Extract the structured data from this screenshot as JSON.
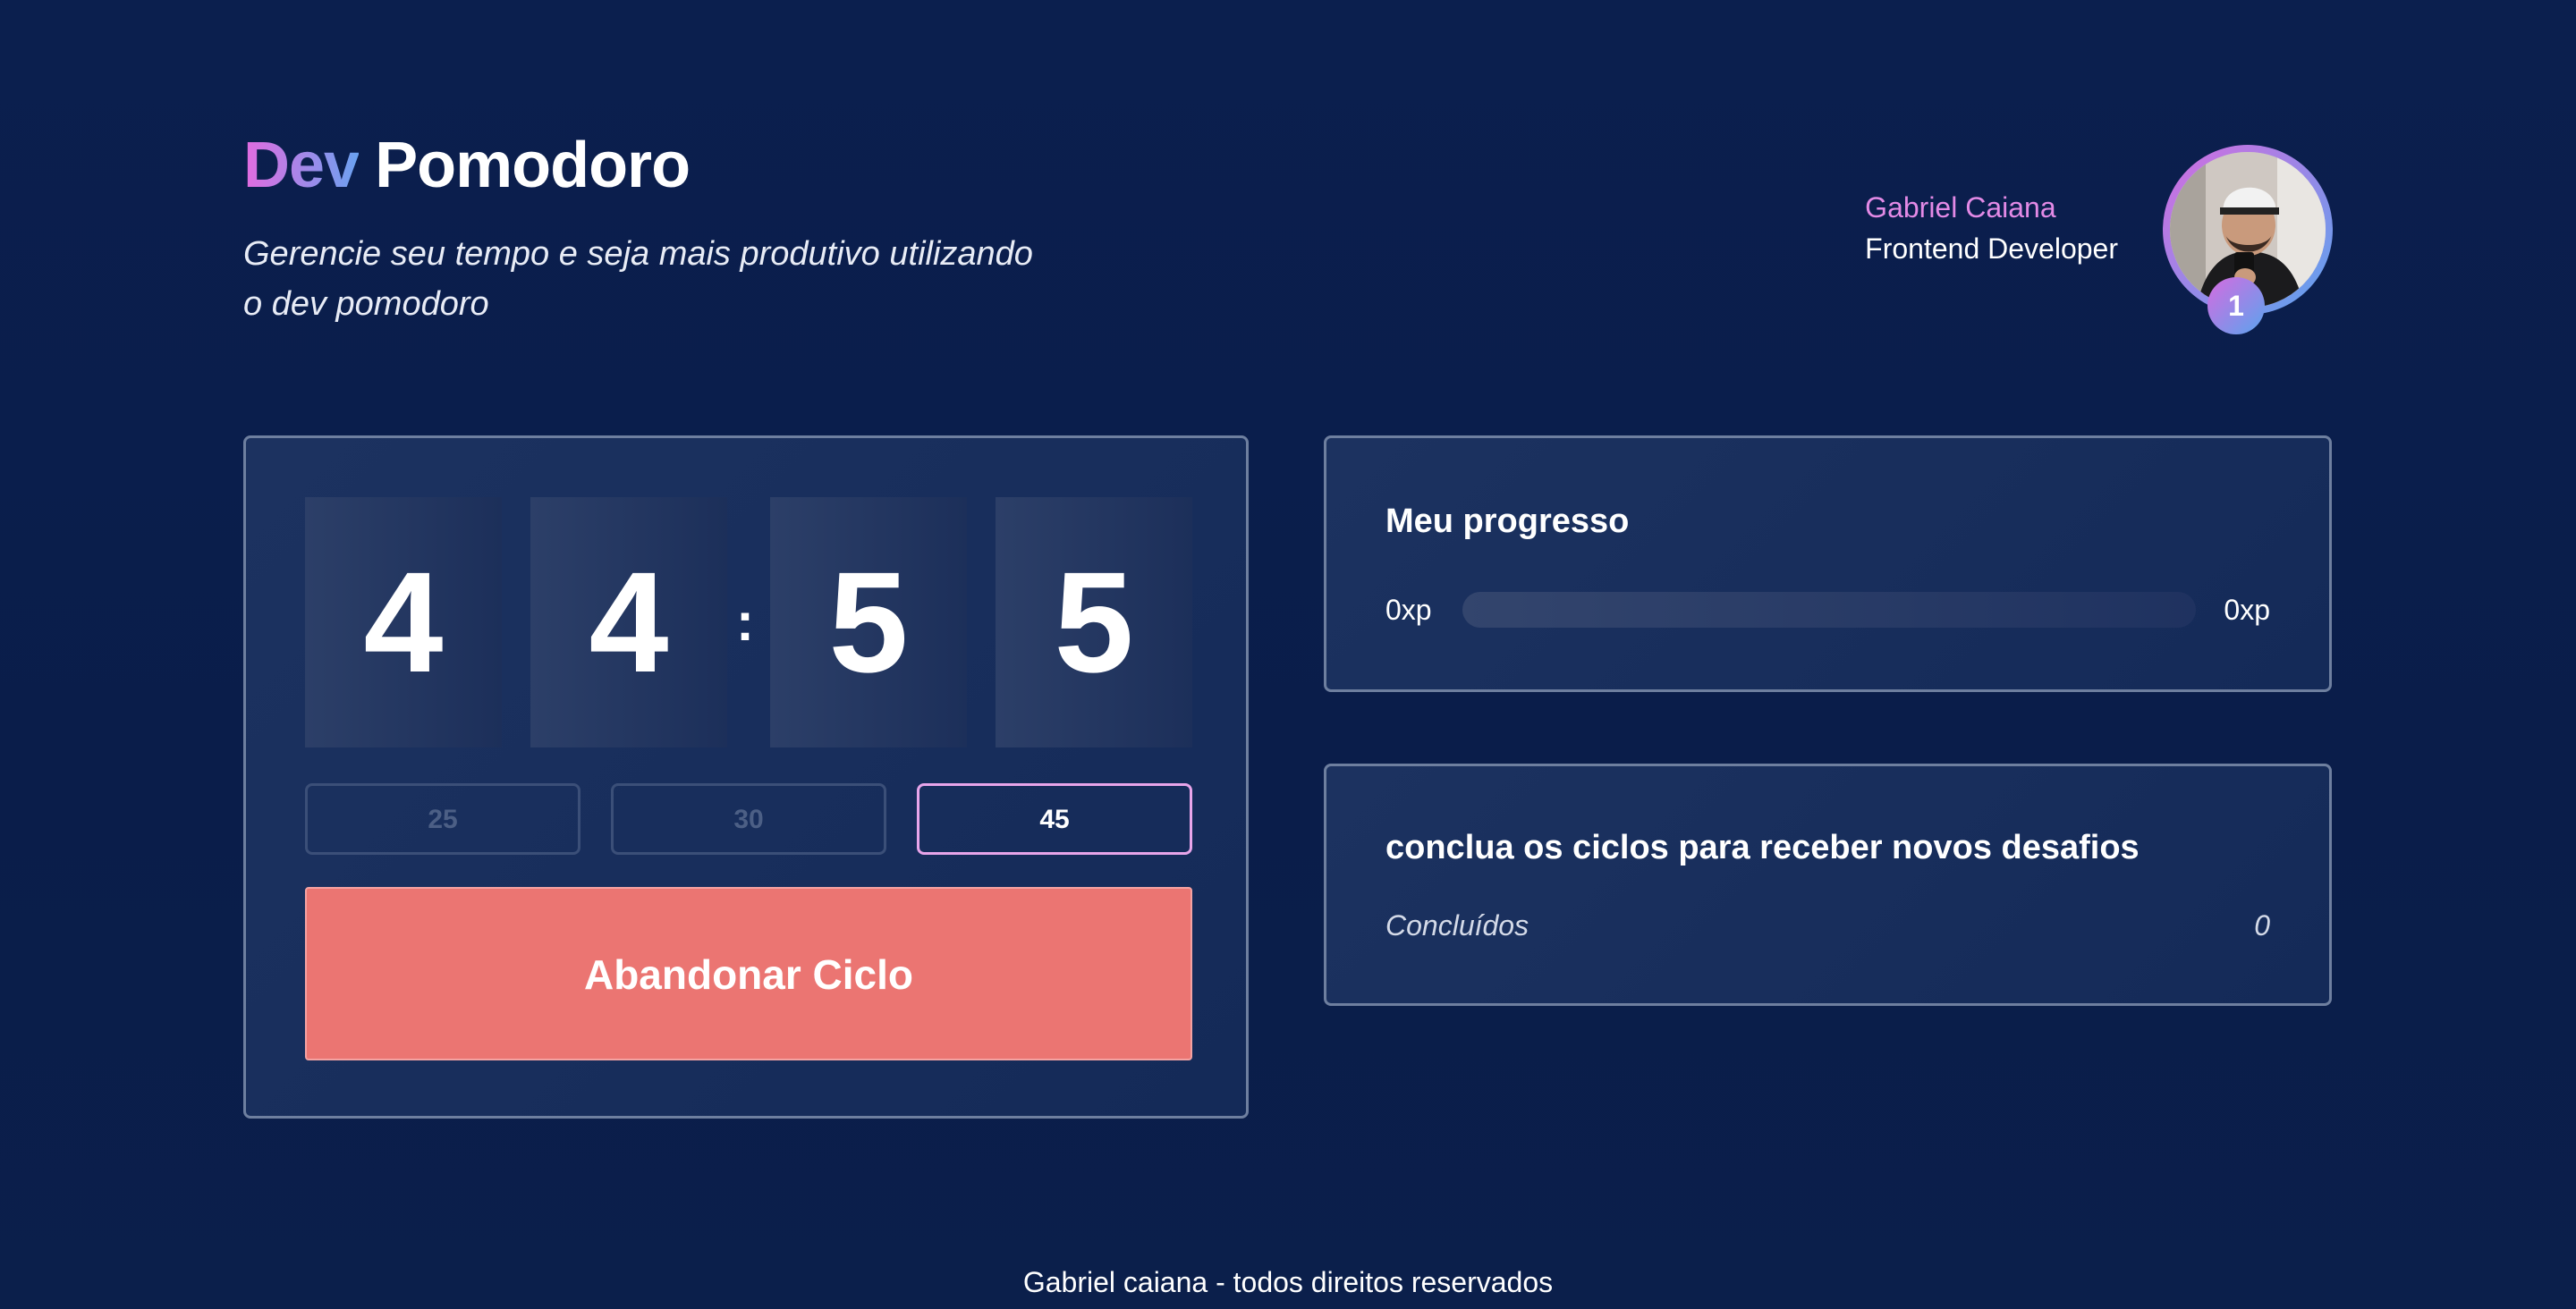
{
  "header": {
    "brand_accent": "Dev",
    "brand_rest": "Pomodoro",
    "subtitle": "Gerencie seu tempo e seja mais produtivo utilizando o dev pomodoro"
  },
  "profile": {
    "name": "Gabriel Caiana",
    "role": "Frontend Developer",
    "level": "1"
  },
  "timer": {
    "minutes": [
      "4",
      "4"
    ],
    "seconds": [
      "5",
      "5"
    ],
    "separator": ":",
    "durations": [
      {
        "label": "25",
        "active": false
      },
      {
        "label": "30",
        "active": false
      },
      {
        "label": "45",
        "active": true
      }
    ],
    "abandon_label": "Abandonar Ciclo"
  },
  "progress": {
    "title": "Meu progresso",
    "current_xp": "0xp",
    "next_xp": "0xp",
    "fill_fraction": 0
  },
  "challenges": {
    "title": "conclua os ciclos para receber novos desafios",
    "done_label": "Concluídos",
    "done_value": "0"
  },
  "footer": {
    "text": "Gabriel caiana - todos direitos reservados"
  },
  "colors": {
    "background": "#0b1f4d",
    "accent_pink": "#d66be0",
    "accent_blue": "#5aa4ee",
    "abandon_red": "#eb7572",
    "card_border": "#6e7f9f"
  }
}
